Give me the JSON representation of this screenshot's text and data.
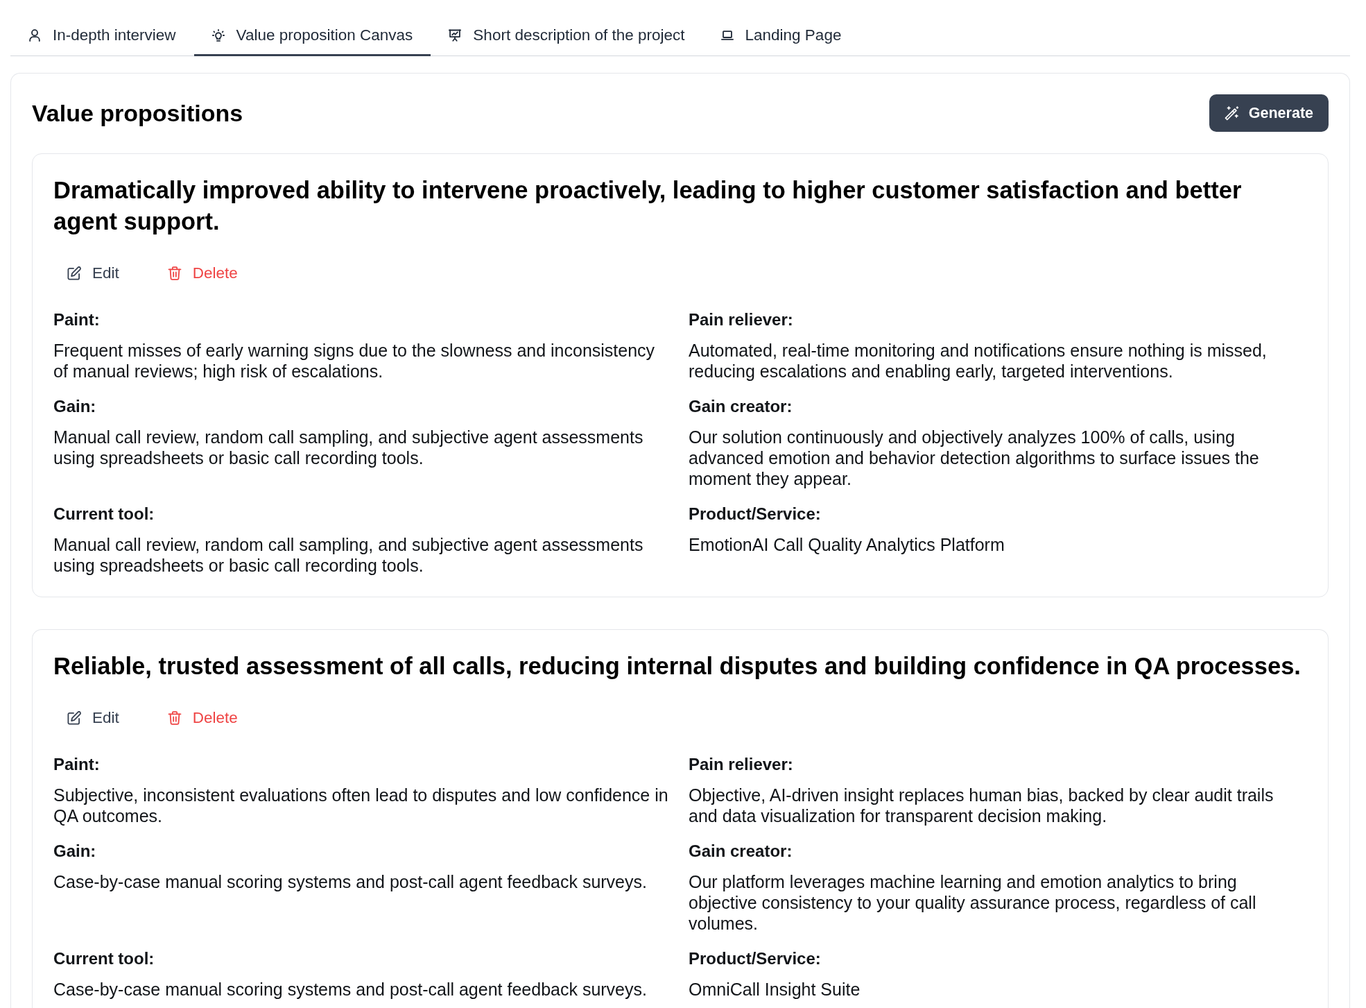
{
  "tabs": [
    {
      "label": "In-depth interview",
      "selected": false
    },
    {
      "label": "Value proposition Canvas",
      "selected": true
    },
    {
      "label": "Short description of the project",
      "selected": false
    },
    {
      "label": "Landing Page",
      "selected": false
    }
  ],
  "panel": {
    "title": "Value propositions",
    "generate_button": "Generate"
  },
  "propositions": [
    {
      "title": "Dramatically improved ability to intervene proactively, leading to higher customer satisfaction and better agent support.",
      "edit_button": "Edit",
      "delete_button": "Delete",
      "fields": [
        {
          "label": "Paint:",
          "text": "Frequent misses of early warning signs due to the slowness and inconsistency of manual reviews; high risk of escalations."
        },
        {
          "label": "Pain reliever:",
          "text": "Automated, real-time monitoring and notifications ensure nothing is missed, reducing escalations and enabling early, targeted interventions."
        },
        {
          "label": "Gain:",
          "text": "Manual call review, random call sampling, and subjective agent assessments using spreadsheets or basic call recording tools."
        },
        {
          "label": "Gain creator:",
          "text": "Our solution continuously and objectively analyzes 100% of calls, using advanced emotion and behavior detection algorithms to surface issues the moment they appear."
        },
        {
          "label": "Current tool:",
          "text": "Manual call review, random call sampling, and subjective agent assessments using spreadsheets or basic call recording tools."
        },
        {
          "label": "Product/Service:",
          "text": "EmotionAI Call Quality Analytics Platform"
        }
      ]
    },
    {
      "title": "Reliable, trusted assessment of all calls, reducing internal disputes and building confidence in QA processes.",
      "edit_button": "Edit",
      "delete_button": "Delete",
      "fields": [
        {
          "label": "Paint:",
          "text": "Subjective, inconsistent evaluations often lead to disputes and low confidence in QA outcomes."
        },
        {
          "label": "Pain reliever:",
          "text": "Objective, AI-driven insight replaces human bias, backed by clear audit trails and data visualization for transparent decision making."
        },
        {
          "label": "Gain:",
          "text": "Case-by-case manual scoring systems and post-call agent feedback surveys."
        },
        {
          "label": "Gain creator:",
          "text": "Our platform leverages machine learning and emotion analytics to bring objective consistency to your quality assurance process, regardless of call volumes."
        },
        {
          "label": "Current tool:",
          "text": "Case-by-case manual scoring systems and post-call agent feedback surveys."
        },
        {
          "label": "Product/Service:",
          "text": "OmniCall Insight Suite"
        }
      ]
    }
  ]
}
